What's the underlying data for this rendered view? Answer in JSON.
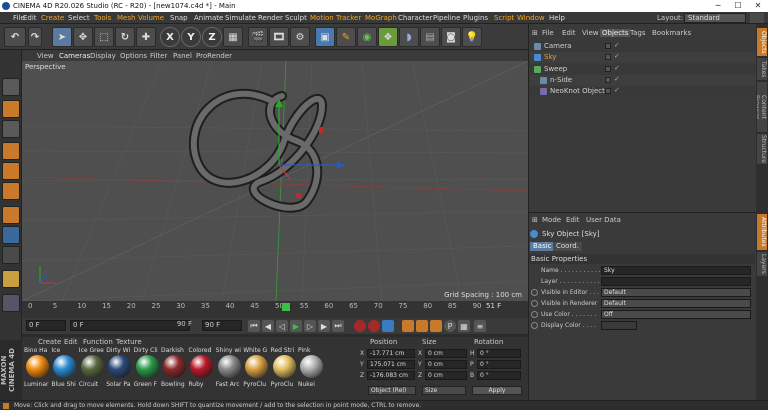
{
  "window": {
    "title": "CINEMA 4D R20.026 Studio (RC - R20) - [new1074.c4d *] - Main"
  },
  "menubar": {
    "items": [
      "File",
      "Edit",
      "Create",
      "Select",
      "Tools",
      "Mesh",
      "Volume",
      "Snap",
      "Animate",
      "Simulate",
      "Render",
      "Sculpt",
      "Motion Tracker",
      "MoGraph",
      "Character",
      "Pipeline",
      "Plugins",
      "Script",
      "Window",
      "Help"
    ],
    "highlighted": [
      "Create",
      "Tools",
      "Mesh",
      "Volume",
      "Motion Tracker",
      "MoGraph",
      "Script",
      "Window"
    ],
    "layout_label": "Layout:",
    "layout_value": "Standard"
  },
  "toolbar": {
    "icons": [
      "undo-icon",
      "redo-icon",
      "live-selection-icon",
      "move-icon",
      "scale-icon",
      "rotate-icon",
      "add-icon",
      "x-axis-icon",
      "y-axis-icon",
      "z-axis-icon",
      "world-coord-icon",
      "render-view-icon",
      "render-picture-viewer-icon",
      "edit-render-settings-icon",
      "cube-icon",
      "pen-icon",
      "subdivision-icon",
      "cloner-icon",
      "deformer-icon",
      "floor-icon",
      "camera-icon",
      "light-icon"
    ],
    "axis_labels": [
      "X",
      "Y",
      "Z"
    ]
  },
  "viewport": {
    "menu": [
      "View",
      "Cameras",
      "Display",
      "Options",
      "Filter",
      "Panel",
      "ProRender"
    ],
    "camera_label": "Perspective",
    "grid_spacing": "Grid Spacing : 100 cm"
  },
  "timeline": {
    "ticks": [
      "0",
      "5",
      "10",
      "15",
      "20",
      "25",
      "30",
      "35",
      "40",
      "45",
      "50",
      "55",
      "60",
      "65",
      "70",
      "75",
      "80",
      "85",
      "90"
    ],
    "current_frame_marker": "51",
    "end_frame": "51 F"
  },
  "time_controls": {
    "start": "0 F",
    "current": "0 F",
    "end_preview": "90 F",
    "end": "90 F"
  },
  "materials": {
    "menu": [
      "Create",
      "Edit",
      "Function",
      "Texture"
    ],
    "top_names": [
      "Bino Ha",
      "Ice",
      "Ice Gree",
      "Dirty Wi",
      "Dirty Cli",
      "Darkish",
      "Colored",
      "Shiny wi",
      "White G",
      "Red Stri",
      "Pink"
    ],
    "labels": [
      "Luminar",
      "Blue Shi",
      "Circuit",
      "Solar Pa",
      "Green F",
      "Bowling",
      "Ruby",
      "Fast Arc",
      "PyroClu",
      "PyroClu",
      "Nukei"
    ],
    "colors": [
      "#f08a10",
      "#2a8ad0",
      "#5a6a40",
      "#2a4a7a",
      "#2a9a4a",
      "#8a2a2a",
      "#b81a2a",
      "#8a8a8a",
      "#d8a040",
      "#e0c060",
      "#b0b0b0"
    ]
  },
  "coordinates": {
    "headers": [
      "Position",
      "Size",
      "Rotation"
    ],
    "rows": [
      {
        "axis": "X",
        "pos": "-17.771 cm",
        "size_axis": "X",
        "size": "0 cm",
        "rot_axis": "H",
        "rot": "0 °"
      },
      {
        "axis": "Y",
        "pos": "175.071 cm",
        "size_axis": "Y",
        "size": "0 cm",
        "rot_axis": "P",
        "rot": "0 °"
      },
      {
        "axis": "Z",
        "pos": "-176.083 cm",
        "size_axis": "Z",
        "size": "0 cm",
        "rot_axis": "B",
        "rot": "0 °"
      }
    ],
    "mode_left": "Object (Rel)",
    "mode_right": "Size",
    "apply": "Apply"
  },
  "objects": {
    "menu": [
      "File",
      "Edit",
      "View",
      "Objects",
      "Tags",
      "Bookmarks"
    ],
    "rows": [
      {
        "name": "Camera",
        "icon_color": "#6a8aaa",
        "name_color": "#cfcfcf",
        "indent": 0
      },
      {
        "name": "Sky",
        "icon_color": "#4a8ad0",
        "name_color": "#f0a030",
        "indent": 0
      },
      {
        "name": "Sweep",
        "icon_color": "#5aaa5a",
        "name_color": "#cfcfcf",
        "indent": 0
      },
      {
        "name": "n-Side",
        "icon_color": "#6a8aaa",
        "name_color": "#cfcfcf",
        "indent": 1
      },
      {
        "name": "NeoKnot Object",
        "icon_color": "#7a6aaa",
        "name_color": "#cfcfcf",
        "indent": 1
      }
    ]
  },
  "attributes": {
    "menu": [
      "Mode",
      "Edit",
      "User Data"
    ],
    "object_title": "Sky Object [Sky]",
    "tabs": [
      "Basic",
      "Coord."
    ],
    "section": "Basic Properties",
    "fields": [
      {
        "label": "Name . . . . . . . . . . .",
        "value": "Sky",
        "type": "text"
      },
      {
        "label": "Layer . . . . . . . . . . .",
        "value": "",
        "type": "text"
      },
      {
        "label": "Visible in Editor . . .",
        "value": "Default",
        "type": "dropdown"
      },
      {
        "label": "Visible in Renderer",
        "value": "Default",
        "type": "dropdown"
      },
      {
        "label": "Use Color . . . . . . .",
        "value": "Off",
        "type": "dropdown"
      },
      {
        "label": "Display Color . . . .",
        "value": "",
        "type": "color"
      }
    ]
  },
  "side_tabs": [
    "Objects",
    "Takes",
    "Content Browser",
    "Structure",
    "Attributes",
    "Layers"
  ],
  "status": "Move: Click and drag to move elements. Hold down SHIFT to quantize movement / add to the selection in point mode, CTRL to remove."
}
